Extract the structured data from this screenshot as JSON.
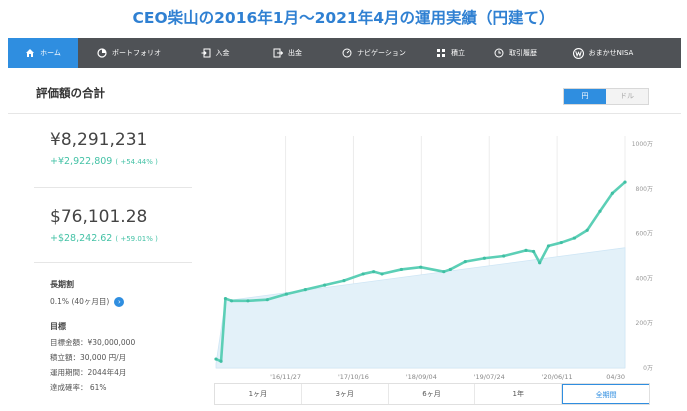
{
  "headline": "CEO柴山の2016年1月〜2021年4月の運用実績（円建て）",
  "nav": [
    {
      "label": "ホーム",
      "icon": "home-icon",
      "active": true
    },
    {
      "label": "ポートフォリオ",
      "icon": "pie-chart-icon",
      "active": false
    },
    {
      "label": "入金",
      "icon": "deposit-icon",
      "active": false
    },
    {
      "label": "出金",
      "icon": "withdraw-icon",
      "active": false
    },
    {
      "label": "ナビゲーション",
      "icon": "compass-icon",
      "active": false
    },
    {
      "label": "積立",
      "icon": "stack-icon",
      "active": false
    },
    {
      "label": "取引履歴",
      "icon": "history-icon",
      "active": false
    },
    {
      "label": "おまかせNISA",
      "icon": "nisa-icon",
      "active": false
    }
  ],
  "panel": {
    "title": "評価額の合計"
  },
  "currency_toggle": {
    "jpy": "円",
    "usd": "ドル",
    "selected": "jpy"
  },
  "summary": {
    "jpy_total": "¥8,291,231",
    "jpy_gain": "+¥2,922,809",
    "jpy_gain_pct": "( +54.44% )",
    "usd_total": "$76,101.28",
    "usd_gain": "+$28,242.62",
    "usd_gain_pct": "( +59.01% )"
  },
  "long_term": {
    "title": "長期割",
    "value": "0.1% (40ヶ月目)",
    "info_icon": "info-arrow-icon"
  },
  "goal": {
    "title": "目標",
    "lines": [
      "目標金額：¥30,000,000",
      "積立額：30,000 円/月",
      "運用期間：2044年4月",
      "達成確率： 61%"
    ]
  },
  "periods": [
    "1ヶ月",
    "3ヶ月",
    "6ヶ月",
    "1年",
    "全期間"
  ],
  "selected_period": "全期間",
  "chart_data": {
    "type": "area",
    "y_unit": "万",
    "y_ticks": [
      "0万",
      "200万",
      "400万",
      "600万",
      "800万",
      "1000万"
    ],
    "y_tick_values": [
      0,
      200,
      400,
      600,
      800,
      1000
    ],
    "ylim": [
      0,
      1000
    ],
    "x_tick_labels": [
      "'16/11/27",
      "'17/10/16",
      "'18/09/04",
      "'19/07/24",
      "'20/06/11",
      "04/30"
    ],
    "grid": "vertical",
    "series": [
      {
        "role": "value",
        "color": "#5ccfb6",
        "x": [
          "2016-01-01",
          "2016-01-25",
          "2016-02-15",
          "2016-03-15",
          "2016-06-01",
          "2016-09-01",
          "2016-12-01",
          "2017-03-01",
          "2017-06-01",
          "2017-09-01",
          "2017-12-01",
          "2018-01-20",
          "2018-03-01",
          "2018-06-01",
          "2018-09-01",
          "2018-12-20",
          "2019-01-20",
          "2019-04-01",
          "2019-07-01",
          "2019-10-01",
          "2020-01-15",
          "2020-02-20",
          "2020-03-20",
          "2020-05-01",
          "2020-07-01",
          "2020-09-01",
          "2020-11-01",
          "2021-01-01",
          "2021-03-01",
          "2021-04-30"
        ],
        "y": [
          40,
          30,
          310,
          300,
          300,
          305,
          330,
          350,
          370,
          390,
          420,
          430,
          420,
          440,
          450,
          430,
          440,
          475,
          490,
          500,
          525,
          520,
          470,
          545,
          560,
          580,
          615,
          700,
          780,
          830
        ]
      },
      {
        "role": "principal",
        "color": "#e3f1f9",
        "x": [
          "2016-01-01",
          "2016-02-15",
          "2021-04-30"
        ],
        "y": [
          20,
          300,
          537
        ]
      }
    ]
  }
}
